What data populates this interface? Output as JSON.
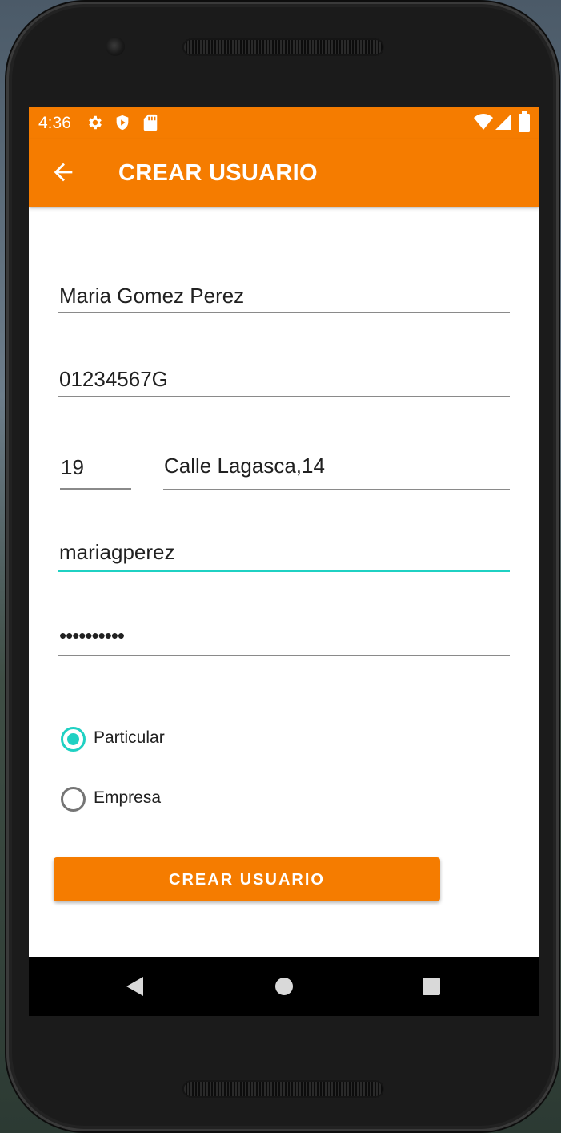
{
  "status_bar": {
    "time": "4:36",
    "left_icons": [
      "gear-icon",
      "shield-icon",
      "sd-card-icon"
    ],
    "right_icons": [
      "wifi-icon",
      "signal-icon",
      "battery-icon"
    ]
  },
  "app_bar": {
    "title": "CREAR USUARIO",
    "color": "#f57c00"
  },
  "form": {
    "name": "Maria Gomez Perez",
    "dni": "01234567G",
    "number": "19",
    "address": "Calle Lagasca,14",
    "username": "mariagperez",
    "password_masked": "••••••••••",
    "focused_field": "username",
    "accent_color": "#1fd1c3"
  },
  "radio_group": {
    "options": [
      "Particular",
      "Empresa"
    ],
    "selected": "Particular"
  },
  "submit_label": "CREAR USUARIO",
  "nav_bar": {
    "buttons": [
      "back-triangle-icon",
      "home-circle-icon",
      "recents-square-icon"
    ]
  }
}
